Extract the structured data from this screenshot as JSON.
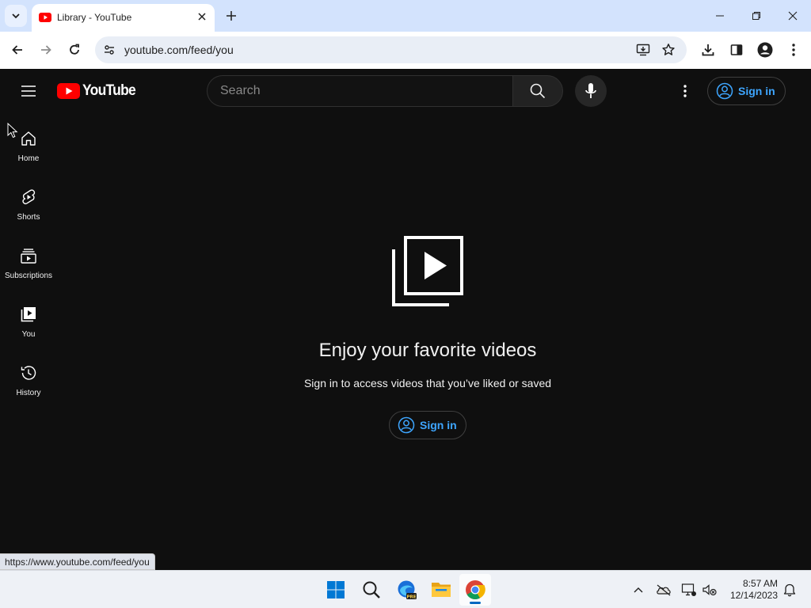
{
  "browser": {
    "tab": {
      "title": "Library - YouTube",
      "favicon": "youtube-favicon"
    },
    "address_bar": {
      "url": "youtube.com/feed/you"
    },
    "status_url": "https://www.youtube.com/feed/you",
    "icons": [
      "tab-search-icon",
      "close-icon",
      "new-tab-icon",
      "minimize-icon",
      "restore-icon",
      "window-close-icon",
      "back-icon",
      "forward-icon",
      "reload-icon",
      "site-info-icon",
      "install-app-icon",
      "bookmark-star-icon",
      "downloads-icon",
      "side-panel-icon",
      "profile-icon",
      "chrome-menu-icon"
    ]
  },
  "youtube": {
    "logo_text": "YouTube",
    "search": {
      "placeholder": "Search"
    },
    "signin_label": "Sign in",
    "guide": [
      {
        "label": "Home",
        "icon": "home-icon"
      },
      {
        "label": "Shorts",
        "icon": "shorts-icon"
      },
      {
        "label": "Subscriptions",
        "icon": "subscriptions-icon"
      },
      {
        "label": "You",
        "icon": "you-library-icon"
      },
      {
        "label": "History",
        "icon": "history-icon"
      }
    ],
    "empty_state": {
      "title": "Enjoy your favorite videos",
      "subtitle": "Sign in to access videos that you’ve liked or saved",
      "button": "Sign in"
    },
    "colors": {
      "background": "#0f0f0f",
      "accent_blue": "#3ea6ff",
      "logo_red": "#ff0000"
    }
  },
  "taskbar": {
    "apps": [
      "windows-start-icon",
      "search-icon",
      "edge-beta-icon",
      "file-explorer-icon",
      "chrome-icon"
    ],
    "active_app": "chrome-icon",
    "tray_icons": [
      "chevron-up-icon",
      "onedrive-icon",
      "network-icon",
      "volume-muted-icon",
      "notification-bell-icon"
    ],
    "time": "8:57 AM",
    "date": "12/14/2023"
  }
}
